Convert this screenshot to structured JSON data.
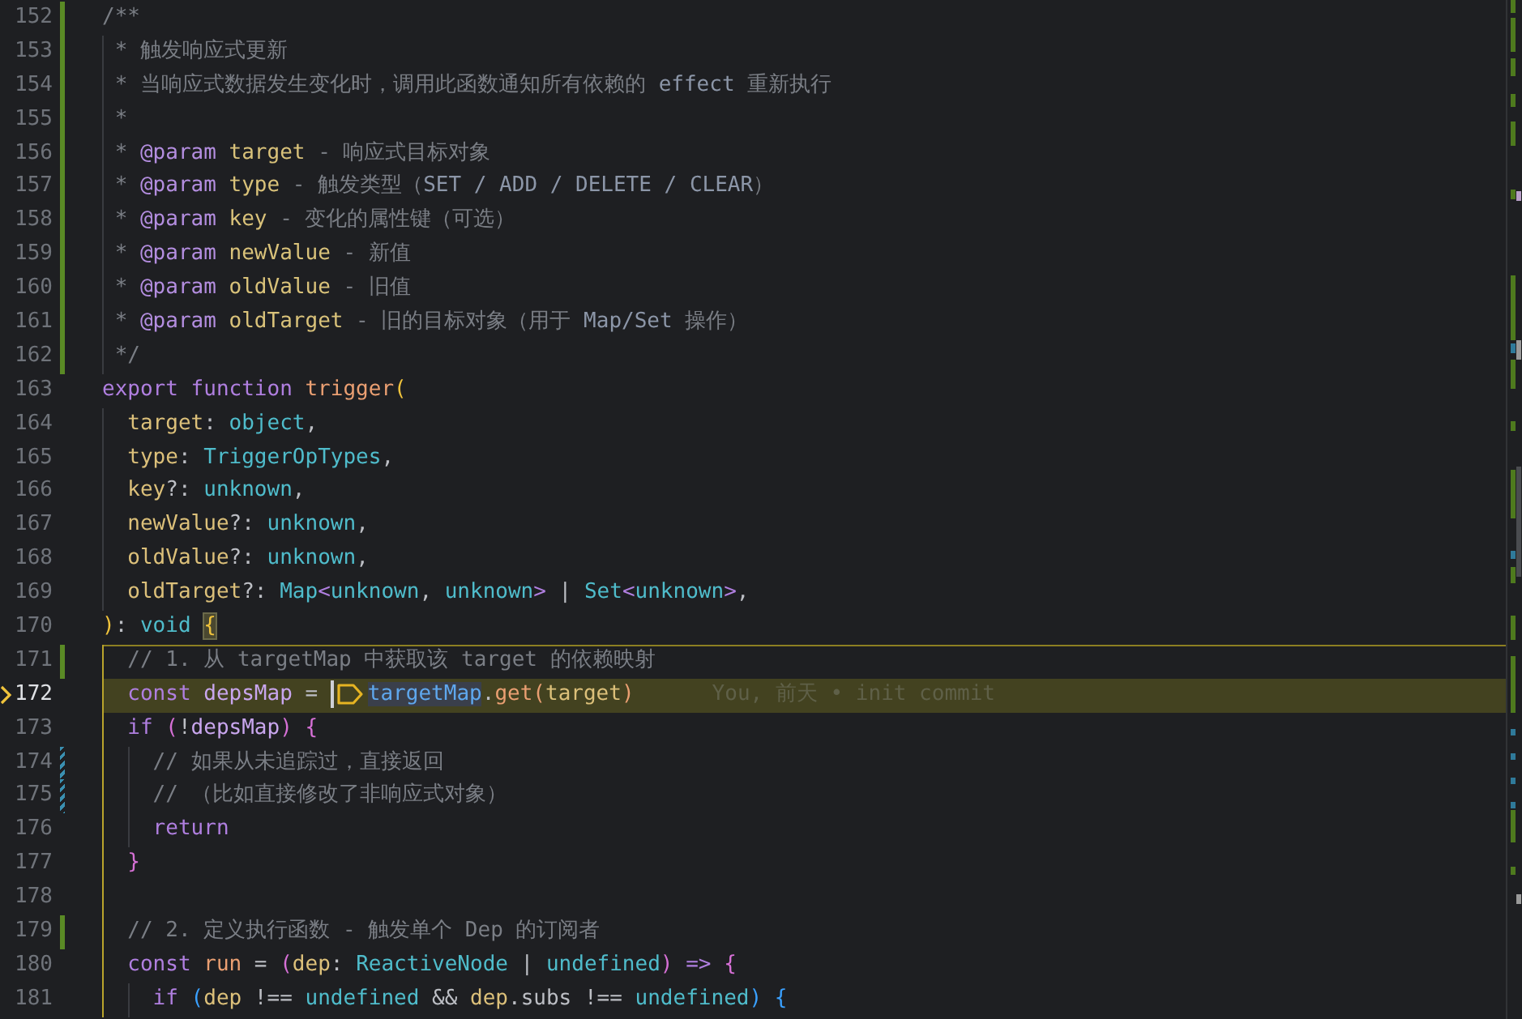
{
  "editor": {
    "lines": [
      {
        "number": "152",
        "added": true,
        "modified": false,
        "tokens": [
          {
            "kind": "comment",
            "text": "/**"
          }
        ]
      },
      {
        "number": "153",
        "added": true,
        "modified": false,
        "tokens": [
          {
            "kind": "comment",
            "text": " * 触发响应式更新"
          }
        ]
      },
      {
        "number": "154",
        "added": true,
        "modified": false,
        "tokens": [
          {
            "kind": "comment",
            "text": " * 当响应式数据发生变化时，调用此函数通知所有依赖的 "
          },
          {
            "kind": "doc-code",
            "text": "effect"
          },
          {
            "kind": "comment",
            "text": " 重新执行"
          }
        ]
      },
      {
        "number": "155",
        "added": true,
        "modified": false,
        "tokens": [
          {
            "kind": "comment",
            "text": " *"
          }
        ]
      },
      {
        "number": "156",
        "added": true,
        "modified": false,
        "tokens": [
          {
            "kind": "comment",
            "text": " * "
          },
          {
            "kind": "doc-tag",
            "text": "@param"
          },
          {
            "kind": "doc-name",
            "text": " target"
          },
          {
            "kind": "comment",
            "text": " - 响应式目标对象"
          }
        ]
      },
      {
        "number": "157",
        "added": true,
        "modified": false,
        "tokens": [
          {
            "kind": "comment",
            "text": " * "
          },
          {
            "kind": "doc-tag",
            "text": "@param"
          },
          {
            "kind": "doc-name",
            "text": " type"
          },
          {
            "kind": "comment",
            "text": " - 触发类型（"
          },
          {
            "kind": "doc-code",
            "text": "SET / ADD / DELETE / CLEAR"
          },
          {
            "kind": "comment",
            "text": "）"
          }
        ]
      },
      {
        "number": "158",
        "added": true,
        "modified": false,
        "tokens": [
          {
            "kind": "comment",
            "text": " * "
          },
          {
            "kind": "doc-tag",
            "text": "@param"
          },
          {
            "kind": "doc-name",
            "text": " key"
          },
          {
            "kind": "comment",
            "text": " - 变化的属性键（可选）"
          }
        ]
      },
      {
        "number": "159",
        "added": true,
        "modified": false,
        "tokens": [
          {
            "kind": "comment",
            "text": " * "
          },
          {
            "kind": "doc-tag",
            "text": "@param"
          },
          {
            "kind": "doc-name",
            "text": " newValue"
          },
          {
            "kind": "comment",
            "text": " - 新值"
          }
        ]
      },
      {
        "number": "160",
        "added": true,
        "modified": false,
        "tokens": [
          {
            "kind": "comment",
            "text": " * "
          },
          {
            "kind": "doc-tag",
            "text": "@param"
          },
          {
            "kind": "doc-name",
            "text": " oldValue"
          },
          {
            "kind": "comment",
            "text": " - 旧值"
          }
        ]
      },
      {
        "number": "161",
        "added": true,
        "modified": false,
        "tokens": [
          {
            "kind": "comment",
            "text": " * "
          },
          {
            "kind": "doc-tag",
            "text": "@param"
          },
          {
            "kind": "doc-name",
            "text": " oldTarget"
          },
          {
            "kind": "comment",
            "text": " - 旧的目标对象（用于 "
          },
          {
            "kind": "doc-code",
            "text": "Map/Set"
          },
          {
            "kind": "comment",
            "text": " 操作）"
          }
        ]
      },
      {
        "number": "162",
        "added": true,
        "modified": false,
        "tokens": [
          {
            "kind": "comment",
            "text": " */"
          }
        ]
      },
      {
        "number": "163",
        "added": false,
        "modified": false,
        "tokens": [
          {
            "kind": "keyword",
            "text": "export function"
          },
          {
            "kind": "function",
            "text": " trigger"
          },
          {
            "kind": "bracket-1",
            "text": "("
          }
        ]
      },
      {
        "number": "164",
        "added": false,
        "modified": false,
        "tokens": [
          {
            "kind": "param",
            "text": "  target"
          },
          {
            "kind": "punct",
            "text": ": "
          },
          {
            "kind": "type",
            "text": "object"
          },
          {
            "kind": "punct",
            "text": ","
          }
        ]
      },
      {
        "number": "165",
        "added": false,
        "modified": false,
        "tokens": [
          {
            "kind": "param",
            "text": "  type"
          },
          {
            "kind": "punct",
            "text": ": "
          },
          {
            "kind": "type",
            "text": "TriggerOpTypes"
          },
          {
            "kind": "punct",
            "text": ","
          }
        ]
      },
      {
        "number": "166",
        "added": false,
        "modified": false,
        "tokens": [
          {
            "kind": "param",
            "text": "  key"
          },
          {
            "kind": "punct",
            "text": "?: "
          },
          {
            "kind": "type",
            "text": "unknown"
          },
          {
            "kind": "punct",
            "text": ","
          }
        ]
      },
      {
        "number": "167",
        "added": false,
        "modified": false,
        "tokens": [
          {
            "kind": "param",
            "text": "  newValue"
          },
          {
            "kind": "punct",
            "text": "?: "
          },
          {
            "kind": "type",
            "text": "unknown"
          },
          {
            "kind": "punct",
            "text": ","
          }
        ]
      },
      {
        "number": "168",
        "added": false,
        "modified": false,
        "tokens": [
          {
            "kind": "param",
            "text": "  oldValue"
          },
          {
            "kind": "punct",
            "text": "?: "
          },
          {
            "kind": "type",
            "text": "unknown"
          },
          {
            "kind": "punct",
            "text": ","
          }
        ]
      },
      {
        "number": "169",
        "added": false,
        "modified": false,
        "tokens": [
          {
            "kind": "param",
            "text": "  oldTarget"
          },
          {
            "kind": "punct",
            "text": "?: "
          },
          {
            "kind": "type",
            "text": "Map"
          },
          {
            "kind": "keyword",
            "text": "<"
          },
          {
            "kind": "type",
            "text": "unknown"
          },
          {
            "kind": "punct",
            "text": ", "
          },
          {
            "kind": "type",
            "text": "unknown"
          },
          {
            "kind": "keyword",
            "text": ">"
          },
          {
            "kind": "punct",
            "text": " | "
          },
          {
            "kind": "type",
            "text": "Set"
          },
          {
            "kind": "keyword",
            "text": "<"
          },
          {
            "kind": "type",
            "text": "unknown"
          },
          {
            "kind": "keyword",
            "text": ">"
          },
          {
            "kind": "punct",
            "text": ","
          }
        ]
      },
      {
        "number": "170",
        "added": false,
        "modified": false,
        "tokens": [
          {
            "kind": "bracket-1",
            "text": ")"
          },
          {
            "kind": "punct",
            "text": ": "
          },
          {
            "kind": "type",
            "text": "void "
          },
          {
            "kind": "bracket-match",
            "text": "{"
          }
        ]
      },
      {
        "number": "171",
        "added": true,
        "modified": false,
        "in_scope": true,
        "scope_start": true,
        "tokens": [
          {
            "kind": "comment",
            "text": "  // 1. 从 targetMap 中获取该 target 的依赖映射"
          }
        ]
      },
      {
        "number": "172",
        "added": false,
        "modified": false,
        "current": true,
        "in_scope": true,
        "blame": "You, 前天 • init commit",
        "tokens": [
          {
            "kind": "keyword",
            "text": "  const"
          },
          {
            "kind": "variable",
            "text": " depsMap"
          },
          {
            "kind": "punct",
            "text": " = "
          },
          {
            "kind": "cursor"
          },
          {
            "kind": "hint"
          },
          {
            "kind": "reference",
            "text": "targetMap"
          },
          {
            "kind": "punct",
            "text": "."
          },
          {
            "kind": "function",
            "text": "get("
          },
          {
            "kind": "param",
            "text": "target"
          },
          {
            "kind": "function",
            "text": ")"
          }
        ]
      },
      {
        "number": "173",
        "added": false,
        "modified": false,
        "in_scope": true,
        "tokens": [
          {
            "kind": "keyword",
            "text": "  if "
          },
          {
            "kind": "bracket-2",
            "text": "("
          },
          {
            "kind": "punct",
            "text": "!"
          },
          {
            "kind": "variable",
            "text": "depsMap"
          },
          {
            "kind": "bracket-2",
            "text": ") {"
          }
        ]
      },
      {
        "number": "174",
        "added": false,
        "modified": true,
        "in_scope": true,
        "tokens": [
          {
            "kind": "comment",
            "text": "    // 如果从未追踪过，直接返回"
          }
        ]
      },
      {
        "number": "175",
        "added": false,
        "modified": true,
        "in_scope": true,
        "tokens": [
          {
            "kind": "comment",
            "text": "    // （比如直接修改了非响应式对象）"
          }
        ]
      },
      {
        "number": "176",
        "added": false,
        "modified": false,
        "in_scope": true,
        "tokens": [
          {
            "kind": "keyword",
            "text": "    return"
          }
        ]
      },
      {
        "number": "177",
        "added": false,
        "modified": false,
        "in_scope": true,
        "tokens": [
          {
            "kind": "bracket-2",
            "text": "  }"
          }
        ]
      },
      {
        "number": "178",
        "added": false,
        "modified": false,
        "in_scope": true
      },
      {
        "number": "179",
        "added": true,
        "modified": false,
        "in_scope": true,
        "tokens": [
          {
            "kind": "comment",
            "text": "  // 2. 定义执行函数 - 触发单个 Dep 的订阅者"
          }
        ]
      },
      {
        "number": "180",
        "added": false,
        "modified": false,
        "in_scope": true,
        "tokens": [
          {
            "kind": "keyword",
            "text": "  const"
          },
          {
            "kind": "function",
            "text": " run"
          },
          {
            "kind": "punct",
            "text": " = "
          },
          {
            "kind": "bracket-2",
            "text": "("
          },
          {
            "kind": "param",
            "text": "dep"
          },
          {
            "kind": "punct",
            "text": ": "
          },
          {
            "kind": "type",
            "text": "ReactiveNode"
          },
          {
            "kind": "punct",
            "text": " | "
          },
          {
            "kind": "type",
            "text": "undefined"
          },
          {
            "kind": "bracket-2",
            "text": ")"
          },
          {
            "kind": "keyword",
            "text": " => "
          },
          {
            "kind": "bracket-2",
            "text": "{"
          }
        ]
      },
      {
        "number": "181",
        "added": false,
        "modified": false,
        "in_scope": true,
        "tokens": [
          {
            "kind": "keyword",
            "text": "    if "
          },
          {
            "kind": "bracket-3",
            "text": "("
          },
          {
            "kind": "param",
            "text": "dep"
          },
          {
            "kind": "punct",
            "text": " !== "
          },
          {
            "kind": "type",
            "text": "undefined"
          },
          {
            "kind": "punct",
            "text": " && "
          },
          {
            "kind": "param",
            "text": "dep"
          },
          {
            "kind": "punct",
            "text": ".subs !== "
          },
          {
            "kind": "type",
            "text": "undefined"
          },
          {
            "kind": "bracket-3",
            "text": ") {"
          }
        ]
      }
    ]
  }
}
